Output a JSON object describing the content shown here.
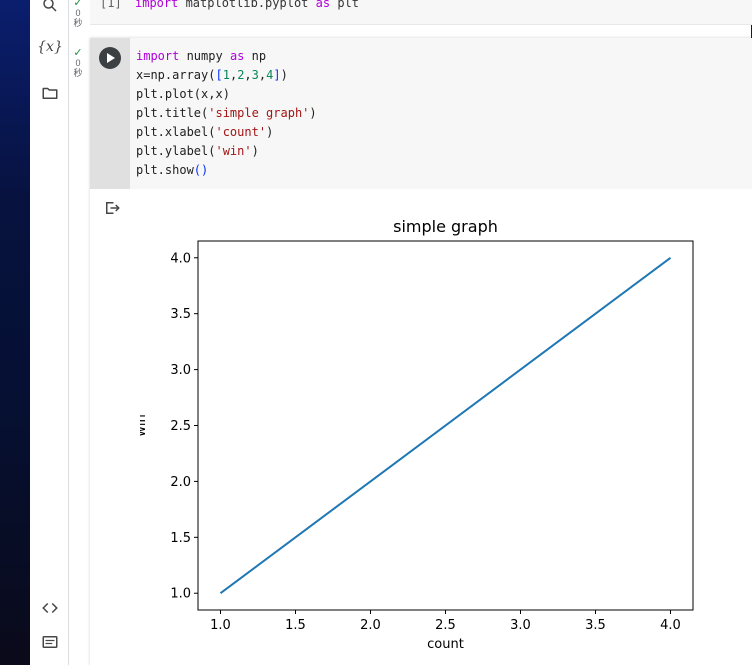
{
  "prev_cell": {
    "exec_count": "[1]",
    "status_time": "0",
    "status_unit": "秒",
    "code_kw": "import",
    "code_rest": " matplotlib.pyplot ",
    "code_as": "as",
    "code_alias": " plt"
  },
  "main_cell": {
    "status_time": "0",
    "status_unit": "秒",
    "lines": {
      "l1_kw": "import",
      "l1_mod": " numpy ",
      "l1_as": "as",
      "l1_alias": " np",
      "l2_a": "x=np.array(",
      "l2_b": "[",
      "l2_n1": "1",
      "l2_c1": ",",
      "l2_n2": "2",
      "l2_c2": ",",
      "l2_n3": "3",
      "l2_c3": ",",
      "l2_n4": "4",
      "l2_e": "]",
      "l2_p": ")",
      "l3": "plt.plot(x,x)",
      "l4_a": "plt.title(",
      "l4_s": "'simple graph'",
      "l4_p": ")",
      "l5_a": "plt.xlabel(",
      "l5_s": "'count'",
      "l5_p": ")",
      "l6_a": "plt.ylabel(",
      "l6_s": "'win'",
      "l6_p": ")",
      "l7_a": "plt.show",
      "l7_p": "()"
    }
  },
  "sidebar": {
    "icons": [
      "search-icon",
      "variables-icon",
      "folder-icon",
      "code-snippets-icon",
      "terminal-icon"
    ],
    "variables_label": "{x}"
  },
  "colors": {
    "line": "#1f77b4",
    "run_button": "#3c4043",
    "keyword": "#af00db",
    "string": "#a31515"
  },
  "chart_data": {
    "type": "line",
    "title": "simple graph",
    "xlabel": "count",
    "ylabel": "win",
    "x": [
      1,
      2,
      3,
      4
    ],
    "series": [
      {
        "values": [
          1,
          2,
          3,
          4
        ]
      }
    ],
    "xlim": [
      0.85,
      4.15
    ],
    "ylim": [
      0.85,
      4.15
    ],
    "xticks": [
      1.0,
      1.5,
      2.0,
      2.5,
      3.0,
      3.5,
      4.0
    ],
    "yticks": [
      1.0,
      1.5,
      2.0,
      2.5,
      3.0,
      3.5,
      4.0
    ],
    "xtick_labels": [
      "1.0",
      "1.5",
      "2.0",
      "2.5",
      "3.0",
      "3.5",
      "4.0"
    ],
    "ytick_labels": [
      "1.0",
      "1.5",
      "2.0",
      "2.5",
      "3.0",
      "3.5",
      "4.0"
    ],
    "grid": false
  }
}
